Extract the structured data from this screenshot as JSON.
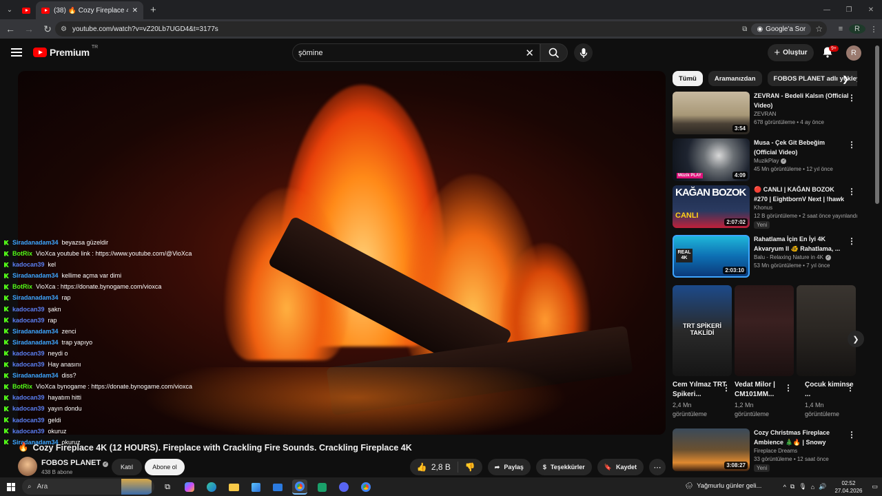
{
  "browser": {
    "tab_title": "(38) 🔥 Cozy Fireplace 4K (12 H",
    "url": "youtube.com/watch?v=vZ20Lb7UGD4&t=3177s",
    "google_ask": "Google'a Sor",
    "profile_letter": "R"
  },
  "header": {
    "logo_text": "Premium",
    "logo_region": "TR",
    "search_value": "şömine",
    "create_label": "Oluştur",
    "notif_badge": "9+",
    "avatar_letter": "R"
  },
  "chat": [
    {
      "user": "Siradanadam34",
      "color": "#3ea6ff",
      "msg": "beyazsa güzeldir"
    },
    {
      "user": "BotRix",
      "color": "#53fc18",
      "msg": "VioXca youtube link : https://www.youtube.com/@VioXca"
    },
    {
      "user": "kadocan39",
      "color": "#5b7ff2",
      "msg": "kel"
    },
    {
      "user": "Siradanadam34",
      "color": "#3ea6ff",
      "msg": "kellime açma var dimi"
    },
    {
      "user": "BotRix",
      "color": "#53fc18",
      "msg": "VioXca : https://donate.bynogame.com/vioxca"
    },
    {
      "user": "Siradanadam34",
      "color": "#3ea6ff",
      "msg": "rap"
    },
    {
      "user": "kadocan39",
      "color": "#5b7ff2",
      "msg": "şakn"
    },
    {
      "user": "kadocan39",
      "color": "#5b7ff2",
      "msg": "rap"
    },
    {
      "user": "Siradanadam34",
      "color": "#3ea6ff",
      "msg": "zenci"
    },
    {
      "user": "Siradanadam34",
      "color": "#3ea6ff",
      "msg": "trap yapıyo"
    },
    {
      "user": "kadocan39",
      "color": "#5b7ff2",
      "msg": "neydi o"
    },
    {
      "user": "kadocan39",
      "color": "#5b7ff2",
      "msg": "Hay anasını"
    },
    {
      "user": "Siradanadam34",
      "color": "#3ea6ff",
      "msg": "diss?"
    },
    {
      "user": "BotRix",
      "color": "#53fc18",
      "msg": "VioXca bynogame : https://donate.bynogame.com/vioxca"
    },
    {
      "user": "kadocan39",
      "color": "#5b7ff2",
      "msg": "hayatım hitti"
    },
    {
      "user": "kadocan39",
      "color": "#5b7ff2",
      "msg": "yayın dondu"
    },
    {
      "user": "kadocan39",
      "color": "#5b7ff2",
      "msg": "geldi"
    },
    {
      "user": "kadocan39",
      "color": "#5b7ff2",
      "msg": "okuruz"
    },
    {
      "user": "Siradanadam34",
      "color": "#3ea6ff",
      "msg": "okuruz"
    }
  ],
  "video": {
    "title": "Cozy Fireplace 4K (12 HOURS). Fireplace with Crackling Fire Sounds. Crackling Fireplace 4K",
    "title_emoji": "🔥",
    "channel": "FOBOS PLANET",
    "subscribers": "438 B abone",
    "join_label": "Katıl",
    "subscribe_label": "Abone ol",
    "likes": "2,8 B",
    "share_label": "Paylaş",
    "thanks_label": "Teşekkürler",
    "save_label": "Kaydet"
  },
  "chips": [
    "Tümü",
    "Aramanızdan",
    "FOBOS PLANET adlı yükleyiciden"
  ],
  "recs": [
    {
      "title": "ZEVRAN - Bedeli Kalsın (Official Video)",
      "channel": "ZEVRAN",
      "views": "678 görüntüleme • 4 ay önce",
      "duration": "3:54",
      "verified": false,
      "new": ""
    },
    {
      "title": "Musa - Çek Git Bebeğim (Official Video)",
      "channel": "MuzikPlay",
      "views": "45 Mn görüntüleme • 12 yıl önce",
      "duration": "4:09",
      "verified": true,
      "new": ""
    },
    {
      "title": "🔴 CANLI | KAĞAN BOZOK #270 | EightbornV Next | !hawk",
      "channel": "Khonus",
      "views": "12 B görüntüleme • 2 saat önce yayınlandı",
      "duration": "2:07:02",
      "verified": false,
      "new": "Yeni"
    },
    {
      "title": "Rahatlama İçin En İyi 4K Akvaryum II 🐠 Rahatlama, ...",
      "channel": "Balu - Relaxing Nature in 4K",
      "views": "53 Mn görüntüleme • 7 yıl önce",
      "duration": "2:03:10",
      "verified": true,
      "new": ""
    },
    {
      "title": "Cozy Christmas Fireplace Ambience 🎄🔥 | Snowy Cabin...",
      "channel": "Fireplace Dreams",
      "views": "33 görüntüleme • 12 saat önce",
      "duration": "3:08:27",
      "verified": false,
      "new": "Yeni"
    }
  ],
  "shorts": [
    {
      "title": "Cem Yılmaz TRT Spikeri...",
      "views": "2,4 Mn görüntüleme",
      "caption": "TRT SPİKERİ TAKLİDİ"
    },
    {
      "title": "Vedat Milor | CM101MM...",
      "views": "1,2 Mn görüntüleme",
      "caption": ""
    },
    {
      "title": "Çocuk kiminse ...",
      "views": "1,4 Mn görüntüleme",
      "caption": ""
    }
  ],
  "thumb_texts": {
    "kagan": "KAĞAN BOZOK",
    "canli": "CANLI",
    "real4k": "REAL 4K",
    "muzik": "Müzik PLAY"
  },
  "taskbar": {
    "search_placeholder": "Ara",
    "weather": "Yağmurlu günler geli...",
    "time": "02:52",
    "date": "27.04.2026"
  }
}
